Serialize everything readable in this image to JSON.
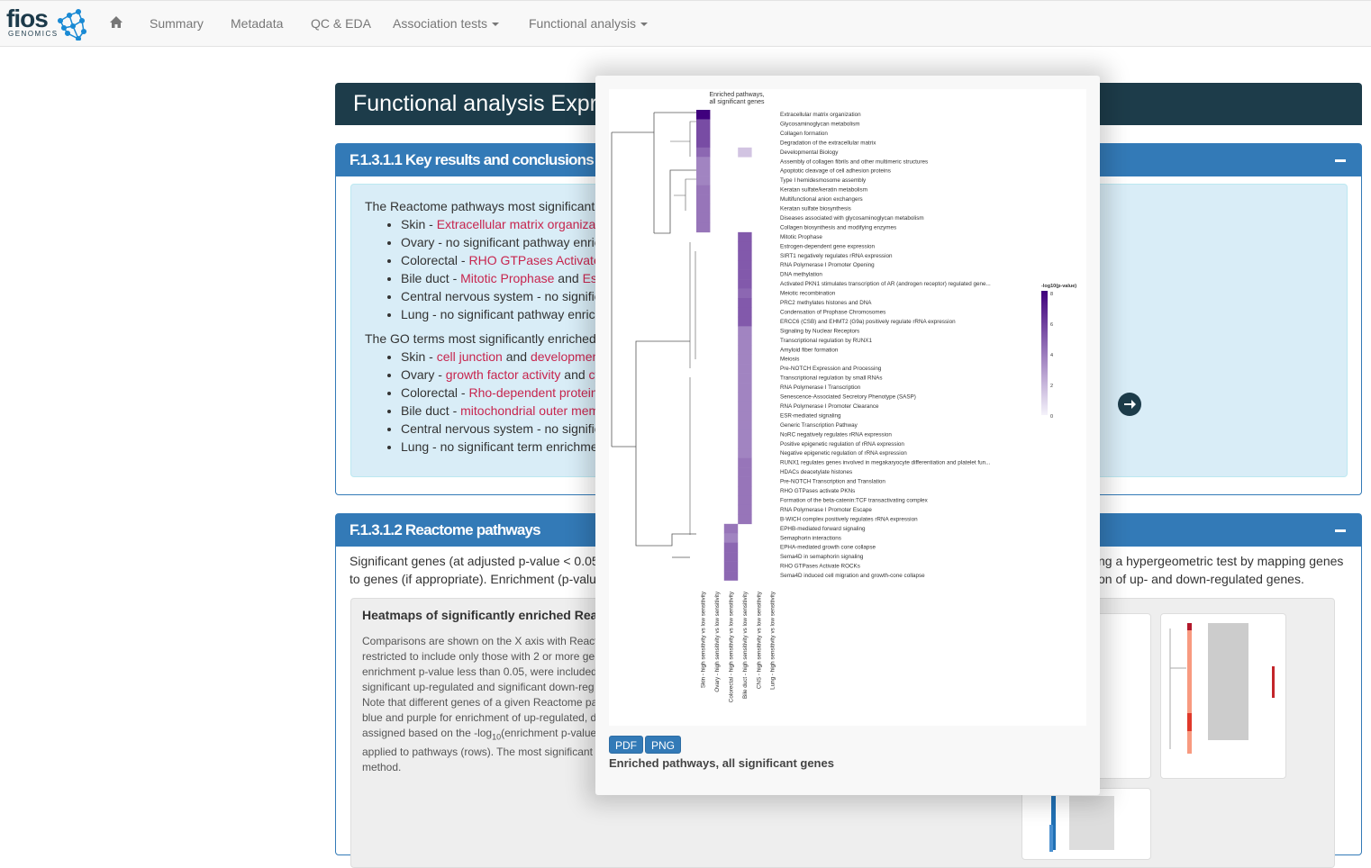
{
  "nav": {
    "logo": "fios",
    "logo_sub": "GENOMICS",
    "items": [
      "Summary",
      "Metadata",
      "QC & EDA",
      "Association tests",
      "Functional analysis"
    ]
  },
  "page_title": "Functional analysis Expr",
  "panel1": {
    "title": "F.1.3.1.1 Key results and conclusions",
    "reactome_intro": "The Reactome pathways most significant",
    "reactome": [
      {
        "tissue": "Skin - ",
        "hl": "Extracellular matrix organizat",
        "rest": ""
      },
      {
        "tissue": "Ovary - no significant pathway enric",
        "hl": "",
        "rest": ""
      },
      {
        "tissue": "Colorectal - ",
        "hl": "RHO GTPases Activate",
        "rest": ""
      },
      {
        "tissue": "Bile duct - ",
        "hl": "Mitotic Prophase",
        "rest": " and ",
        "hl2": "Es"
      },
      {
        "tissue": "Central nervous system - no signific",
        "hl": "",
        "rest": ""
      },
      {
        "tissue": "Lung - no significant pathway enrich",
        "hl": "",
        "rest": ""
      }
    ],
    "go_intro": "The GO terms most significantly enriched",
    "go": [
      {
        "tissue": "Skin - ",
        "hl": "cell junction",
        "rest": " and ",
        "hl2": "developmen"
      },
      {
        "tissue": "Ovary - ",
        "hl": "growth factor activity",
        "rest": " and ",
        "hl2": "cy"
      },
      {
        "tissue": "Colorectal - ",
        "hl": "Rho-dependent protein",
        "rest": ""
      },
      {
        "tissue": "Bile duct - ",
        "hl": "mitochondrial outer mem",
        "rest": ""
      },
      {
        "tissue": "Central nervous system - no signific",
        "hl": "",
        "rest": ""
      },
      {
        "tissue": "Lung - no significant term enrichme",
        "hl": "",
        "rest": ""
      }
    ]
  },
  "panel2": {
    "title": "F.1.3.1.2 Reactome pathways",
    "intro_left": [
      "Significant genes (at adjusted p-value < 0.05",
      "to genes (if appropriate). Enrichment (p-valu"
    ],
    "intro_right": [
      "ng a hypergeometric test by mapping genes",
      "on of up- and down-regulated genes."
    ],
    "well_title": "Heatmaps of significantly enriched Reacto",
    "well_lines": [
      "Comparisons are shown on the X axis with React",
      "restricted to include only those with 2 or more ge",
      "enrichment p-value less than 0.05, were included",
      "significant up-regulated and significant down-reg",
      "Note that different genes of a given Reactome pa",
      "blue and purple for enrichment of up-regulated, d"
    ],
    "well_log_pre": "assigned based on the -log",
    "well_log_sub": "10",
    "well_log_post": "(enrichment p-value",
    "well_lines2": [
      "applied to pathways (rows). The most significant",
      "method."
    ]
  },
  "modal": {
    "pdf": "PDF",
    "png": "PNG",
    "caption": "Enriched pathways, all significant genes"
  },
  "chart_data": {
    "type": "heatmap",
    "title": "Enriched pathways,\nall significant genes",
    "legend_title": "-log10(p-value)",
    "legend_ticks": [
      8,
      6,
      4,
      2,
      0
    ],
    "color_low": "#f4f2fa",
    "color_high": "#3f007d",
    "columns": [
      "Skin - high sensitivity vs low sensitivity",
      "Ovary - high sensitivity vs low sensitivity",
      "Colorectal - high sensitivity vs low sensitivity",
      "Bile duct - high sensitivity vs low sensitivity",
      "CNS - high sensitivity vs low sensitivity",
      "Lung - high sensitivity vs low sensitivity"
    ],
    "rows": [
      "Extracellular matrix organization",
      "Glycosaminoglycan metabolism",
      "Collagen formation",
      "Degradation of the extracellular matrix",
      "Developmental Biology",
      "Assembly of collagen fibrils and other multimeric structures",
      "Apoptotic cleavage of cell adhesion  proteins",
      "Type I hemidesmosome assembly",
      "Keratan sulfate/keratin metabolism",
      "Multifunctional anion exchangers",
      "Keratan sulfate biosynthesis",
      "Diseases associated with glycosaminoglycan metabolism",
      "Collagen biosynthesis and modifying enzymes",
      "Mitotic Prophase",
      "Estrogen-dependent gene expression",
      "SIRT1 negatively regulates rRNA expression",
      "RNA Polymerase I Promoter Opening",
      "DNA methylation",
      "Activated PKN1 stimulates transcription of AR (androgen receptor) regulated gene...",
      "Meiotic recombination",
      "PRC2 methylates histones and DNA",
      "Condensation of Prophase Chromosomes",
      "ERCC6 (CSB) and EHMT2 (G9a) positively regulate rRNA expression",
      "Signaling by Nuclear Receptors",
      "Transcriptional regulation by RUNX1",
      "Amyloid fiber formation",
      "Meiosis",
      "Pre-NOTCH Expression and Processing",
      "Transcriptional regulation by small RNAs",
      "RNA Polymerase I Transcription",
      "Senescence-Associated Secretory Phenotype (SASP)",
      "RNA Polymerase I Promoter Clearance",
      "ESR-mediated signaling",
      "Generic Transcription Pathway",
      "NoRC negatively regulates rRNA expression",
      "Positive epigenetic regulation of rRNA expression",
      "Negative epigenetic regulation of rRNA expression",
      "RUNX1 regulates genes involved in megakaryocyte differentiation and platelet fun...",
      "HDACs deacetylate histones",
      "Pre-NOTCH Transcription and Translation",
      "RHO GTPases activate PKNs",
      "Formation of the beta-catenin:TCF transactivating complex",
      "RNA Polymerase I Promoter Escape",
      "B-WICH complex positively regulates rRNA expression",
      "EPHB-mediated forward signaling",
      "Semaphorin interactions",
      "EPHA-mediated growth cone collapse",
      "Sema4D in semaphorin signaling",
      "RHO GTPases Activate ROCKs",
      "Sema4D induced cell migration and growth-cone collapse"
    ],
    "values": [
      [
        8,
        null,
        null,
        null,
        null,
        null
      ],
      [
        5,
        null,
        null,
        null,
        null,
        null
      ],
      [
        5,
        null,
        null,
        null,
        null,
        null
      ],
      [
        5,
        null,
        null,
        null,
        null,
        null
      ],
      [
        4,
        null,
        null,
        1,
        null,
        null
      ],
      [
        3,
        null,
        null,
        null,
        null,
        null
      ],
      [
        3,
        null,
        null,
        null,
        null,
        null
      ],
      [
        3,
        null,
        null,
        null,
        null,
        null
      ],
      [
        3.5,
        null,
        null,
        null,
        null,
        null
      ],
      [
        3.5,
        null,
        null,
        null,
        null,
        null
      ],
      [
        3.5,
        null,
        null,
        null,
        null,
        null
      ],
      [
        3.5,
        null,
        null,
        null,
        null,
        null
      ],
      [
        3.5,
        null,
        null,
        null,
        null,
        null
      ],
      [
        null,
        null,
        null,
        4.5,
        null,
        null
      ],
      [
        null,
        null,
        null,
        4.5,
        null,
        null
      ],
      [
        null,
        null,
        null,
        4.5,
        null,
        null
      ],
      [
        null,
        null,
        null,
        4.5,
        null,
        null
      ],
      [
        null,
        null,
        null,
        4.5,
        null,
        null
      ],
      [
        null,
        null,
        null,
        4.5,
        null,
        null
      ],
      [
        null,
        null,
        null,
        4,
        null,
        null
      ],
      [
        null,
        null,
        null,
        4.5,
        null,
        null
      ],
      [
        null,
        null,
        null,
        4.5,
        null,
        null
      ],
      [
        null,
        null,
        null,
        4.5,
        null,
        null
      ],
      [
        null,
        null,
        null,
        3,
        null,
        null
      ],
      [
        null,
        null,
        null,
        3,
        null,
        null
      ],
      [
        null,
        null,
        null,
        3,
        null,
        null
      ],
      [
        null,
        null,
        null,
        3,
        null,
        null
      ],
      [
        null,
        null,
        null,
        3,
        null,
        null
      ],
      [
        null,
        null,
        null,
        3,
        null,
        null
      ],
      [
        null,
        null,
        null,
        3,
        null,
        null
      ],
      [
        null,
        null,
        null,
        3,
        null,
        null
      ],
      [
        null,
        null,
        null,
        3,
        null,
        null
      ],
      [
        null,
        null,
        null,
        3,
        null,
        null
      ],
      [
        null,
        null,
        null,
        3,
        null,
        null
      ],
      [
        null,
        null,
        null,
        3,
        null,
        null
      ],
      [
        null,
        null,
        null,
        3,
        null,
        null
      ],
      [
        null,
        null,
        null,
        3,
        null,
        null
      ],
      [
        null,
        null,
        null,
        3.5,
        null,
        null
      ],
      [
        null,
        null,
        null,
        3.5,
        null,
        null
      ],
      [
        null,
        null,
        null,
        3.5,
        null,
        null
      ],
      [
        null,
        null,
        null,
        3.5,
        null,
        null
      ],
      [
        null,
        null,
        null,
        3.5,
        null,
        null
      ],
      [
        null,
        null,
        null,
        3.5,
        null,
        null
      ],
      [
        null,
        null,
        null,
        3.5,
        null,
        null
      ],
      [
        null,
        null,
        3.5,
        null,
        null,
        null
      ],
      [
        null,
        null,
        3,
        null,
        null,
        null
      ],
      [
        null,
        null,
        4,
        null,
        null,
        null
      ],
      [
        null,
        null,
        4,
        null,
        null,
        null
      ],
      [
        null,
        null,
        4,
        null,
        null,
        null
      ],
      [
        null,
        null,
        4,
        null,
        null,
        null
      ]
    ]
  }
}
